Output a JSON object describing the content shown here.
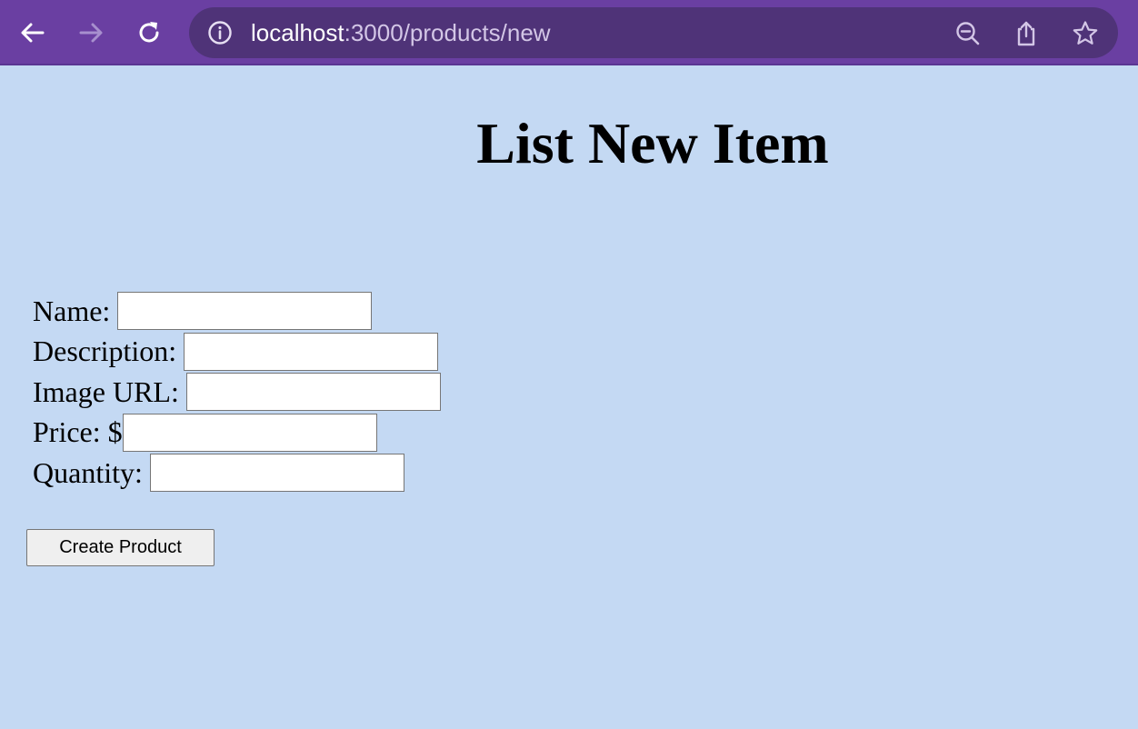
{
  "browser": {
    "url_host": "localhost",
    "url_path": ":3000/products/new",
    "icons": {
      "back": "back-arrow-icon",
      "forward": "forward-arrow-icon",
      "reload": "reload-icon",
      "site_info": "info-icon",
      "zoom": "zoom-out-icon",
      "share": "share-icon",
      "bookmark": "star-icon"
    },
    "colors": {
      "toolbar": "#6a3fa2",
      "omnibox": "#4f3378",
      "page_background": "#c4d9f3"
    }
  },
  "page": {
    "title": "List New Item"
  },
  "form": {
    "fields": [
      {
        "label": "Name:",
        "value": "",
        "placeholder": ""
      },
      {
        "label": "Description:",
        "value": "",
        "placeholder": ""
      },
      {
        "label": "Image URL:",
        "value": "",
        "placeholder": ""
      },
      {
        "label": "Price: $",
        "value": "",
        "placeholder": ""
      },
      {
        "label": "Quantity:",
        "value": "",
        "placeholder": ""
      }
    ],
    "submit_label": "Create Product"
  }
}
